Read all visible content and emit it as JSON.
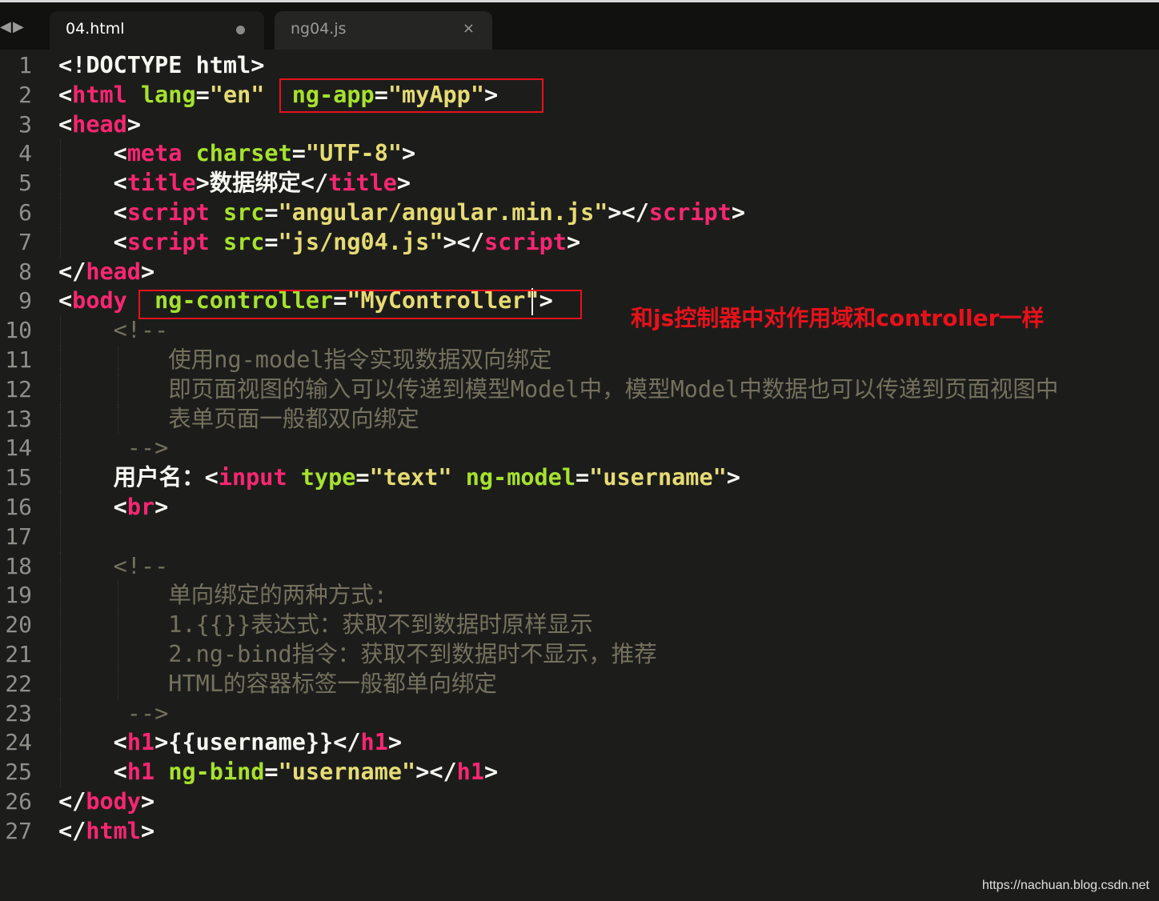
{
  "tabs": [
    {
      "label": "04.html",
      "active": true,
      "modified": true
    },
    {
      "label": "ng04.js",
      "active": false,
      "close": "×"
    }
  ],
  "nav": {
    "left_icon": "◀",
    "right_icon": "▶"
  },
  "colors": {
    "background": "#1c1d1b",
    "tag": "#f92672",
    "attribute": "#a6e22e",
    "string": "#e6db74",
    "comment": "#75715e",
    "highlight": "#e8111a"
  },
  "lines": [
    {
      "n": "1",
      "tokens": [
        [
          "p",
          "<!DOCTYPE html>"
        ]
      ]
    },
    {
      "n": "2",
      "tokens": [
        [
          "p",
          "<"
        ],
        [
          "tag",
          "html"
        ],
        [
          "txt",
          " "
        ],
        [
          "attr",
          "lang"
        ],
        [
          "p",
          "="
        ],
        [
          "str",
          "\"en\""
        ],
        [
          "txt",
          "  "
        ],
        [
          "attr",
          "ng-app"
        ],
        [
          "p",
          "="
        ],
        [
          "str",
          "\"myApp\""
        ],
        [
          "p",
          ">"
        ]
      ]
    },
    {
      "n": "3",
      "tokens": [
        [
          "p",
          "<"
        ],
        [
          "tag",
          "head"
        ],
        [
          "p",
          ">"
        ]
      ]
    },
    {
      "n": "4",
      "tokens": [
        [
          "txt",
          "    "
        ],
        [
          "p",
          "<"
        ],
        [
          "tag",
          "meta"
        ],
        [
          "txt",
          " "
        ],
        [
          "attr",
          "charset"
        ],
        [
          "p",
          "="
        ],
        [
          "str",
          "\"UTF-8\""
        ],
        [
          "p",
          ">"
        ]
      ]
    },
    {
      "n": "5",
      "tokens": [
        [
          "txt",
          "    "
        ],
        [
          "p",
          "<"
        ],
        [
          "tag",
          "title"
        ],
        [
          "p",
          ">"
        ],
        [
          "txt",
          "数据绑定"
        ],
        [
          "p",
          "</"
        ],
        [
          "tag",
          "title"
        ],
        [
          "p",
          ">"
        ]
      ]
    },
    {
      "n": "6",
      "tokens": [
        [
          "txt",
          "    "
        ],
        [
          "p",
          "<"
        ],
        [
          "tag",
          "script"
        ],
        [
          "txt",
          " "
        ],
        [
          "attr",
          "src"
        ],
        [
          "p",
          "="
        ],
        [
          "str",
          "\"angular/angular.min.js\""
        ],
        [
          "p",
          "></"
        ],
        [
          "tag",
          "script"
        ],
        [
          "p",
          ">"
        ]
      ]
    },
    {
      "n": "7",
      "tokens": [
        [
          "txt",
          "    "
        ],
        [
          "p",
          "<"
        ],
        [
          "tag",
          "script"
        ],
        [
          "txt",
          " "
        ],
        [
          "attr",
          "src"
        ],
        [
          "p",
          "="
        ],
        [
          "str",
          "\"js/ng04.js\""
        ],
        [
          "p",
          "></"
        ],
        [
          "tag",
          "script"
        ],
        [
          "p",
          ">"
        ]
      ]
    },
    {
      "n": "8",
      "tokens": [
        [
          "p",
          "</"
        ],
        [
          "tag",
          "head"
        ],
        [
          "p",
          ">"
        ]
      ]
    },
    {
      "n": "9",
      "tokens": [
        [
          "p",
          "<"
        ],
        [
          "tag",
          "body"
        ],
        [
          "txt",
          "  "
        ],
        [
          "attr",
          "ng-controller"
        ],
        [
          "p",
          "="
        ],
        [
          "str",
          "\"MyController\""
        ],
        [
          "p",
          ">"
        ]
      ]
    },
    {
      "n": "10",
      "tokens": [
        [
          "txt",
          "    "
        ],
        [
          "cmt",
          "<!--"
        ]
      ]
    },
    {
      "n": "11",
      "tokens": [
        [
          "txt",
          "        "
        ],
        [
          "cmt",
          "使用ng-model指令实现数据双向绑定"
        ]
      ]
    },
    {
      "n": "12",
      "tokens": [
        [
          "txt",
          "        "
        ],
        [
          "cmt",
          "即页面视图的输入可以传递到模型Model中，模型Model中数据也可以传递到页面视图中"
        ]
      ]
    },
    {
      "n": "13",
      "tokens": [
        [
          "txt",
          "        "
        ],
        [
          "cmt",
          "表单页面一般都双向绑定"
        ]
      ]
    },
    {
      "n": "14",
      "tokens": [
        [
          "txt",
          "     "
        ],
        [
          "cmt",
          "-->"
        ]
      ]
    },
    {
      "n": "15",
      "tokens": [
        [
          "txt",
          "    用户名："
        ],
        [
          "p",
          "<"
        ],
        [
          "tag",
          "input"
        ],
        [
          "txt",
          " "
        ],
        [
          "attr",
          "type"
        ],
        [
          "p",
          "="
        ],
        [
          "str",
          "\"text\""
        ],
        [
          "txt",
          " "
        ],
        [
          "attr",
          "ng-model"
        ],
        [
          "p",
          "="
        ],
        [
          "str",
          "\"username\""
        ],
        [
          "p",
          ">"
        ]
      ]
    },
    {
      "n": "16",
      "tokens": [
        [
          "txt",
          "    "
        ],
        [
          "p",
          "<"
        ],
        [
          "tag",
          "br"
        ],
        [
          "p",
          ">"
        ]
      ]
    },
    {
      "n": "17",
      "tokens": []
    },
    {
      "n": "18",
      "tokens": [
        [
          "txt",
          "    "
        ],
        [
          "cmt",
          "<!--"
        ]
      ]
    },
    {
      "n": "19",
      "tokens": [
        [
          "txt",
          "        "
        ],
        [
          "cmt",
          "单向绑定的两种方式:"
        ]
      ]
    },
    {
      "n": "20",
      "tokens": [
        [
          "txt",
          "        "
        ],
        [
          "cmt",
          "1.{{}}表达式：获取不到数据时原样显示"
        ]
      ]
    },
    {
      "n": "21",
      "tokens": [
        [
          "txt",
          "        "
        ],
        [
          "cmt",
          "2.ng-bind指令：获取不到数据时不显示，推荐"
        ]
      ]
    },
    {
      "n": "22",
      "tokens": [
        [
          "txt",
          "        "
        ],
        [
          "cmt",
          "HTML的容器标签一般都单向绑定"
        ]
      ]
    },
    {
      "n": "23",
      "tokens": [
        [
          "txt",
          "     "
        ],
        [
          "cmt",
          "-->"
        ]
      ]
    },
    {
      "n": "24",
      "tokens": [
        [
          "txt",
          "    "
        ],
        [
          "p",
          "<"
        ],
        [
          "tag",
          "h1"
        ],
        [
          "p",
          ">"
        ],
        [
          "txt",
          "{{username}}"
        ],
        [
          "p",
          "</"
        ],
        [
          "tag",
          "h1"
        ],
        [
          "p",
          ">"
        ]
      ]
    },
    {
      "n": "25",
      "tokens": [
        [
          "txt",
          "    "
        ],
        [
          "p",
          "<"
        ],
        [
          "tag",
          "h1"
        ],
        [
          "txt",
          " "
        ],
        [
          "attr",
          "ng-bind"
        ],
        [
          "p",
          "="
        ],
        [
          "str",
          "\"username\""
        ],
        [
          "p",
          "></"
        ],
        [
          "tag",
          "h1"
        ],
        [
          "p",
          ">"
        ]
      ]
    },
    {
      "n": "26",
      "tokens": [
        [
          "p",
          "</"
        ],
        [
          "tag",
          "body"
        ],
        [
          "p",
          ">"
        ]
      ]
    },
    {
      "n": "27",
      "tokens": [
        [
          "p",
          "</"
        ],
        [
          "tag",
          "html"
        ],
        [
          "p",
          ">"
        ]
      ]
    }
  ],
  "annotation": "和js控制器中对作用域和controller一样",
  "watermark": "https://nachuan.blog.csdn.net"
}
